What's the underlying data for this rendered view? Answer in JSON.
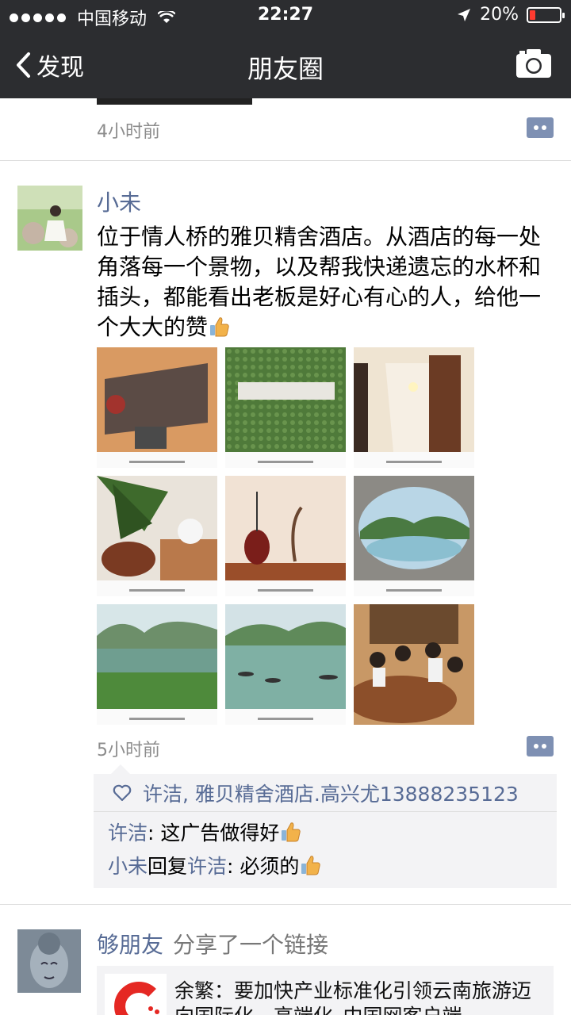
{
  "status": {
    "carrier": "中国移动",
    "time": "22:27",
    "battery": "20%",
    "battery_level": 0.2
  },
  "nav": {
    "back_label": "发现",
    "title": "朋友圈"
  },
  "prev_post": {
    "time": "4小时前"
  },
  "post": {
    "author": "小未",
    "text": "位于情人桥的雅贝精舍酒店。从酒店的每一处角落每一个景物，以及帮我快递遗忘的水杯和插头，都能看出老板是好心有心的人，给他一个大大的赞",
    "time": "5小时前",
    "likes": "许洁, 雅贝精舍酒店.高兴尤13888235123",
    "comments": [
      {
        "from": "许洁",
        "to": "",
        "reply_word": "",
        "text": ": 这广告做得好"
      },
      {
        "from": "小未",
        "to": "许洁",
        "reply_word": "回复",
        "text": ": 必须的"
      }
    ],
    "photo_labels": [
      "雅贝精舍 sign",
      "雅贝精舍 green wall",
      "hallway",
      "lotus",
      "vase decor",
      "round window view",
      "lake view",
      "boats on river",
      "dinner group"
    ]
  },
  "next_post": {
    "author": "够朋友",
    "verb": "分享了一个链接",
    "link_text": "余繁：要加快产业标准化引领云南旅游迈向国际化、高端化_中国网客户端"
  },
  "colors": {
    "topbar": "#2c2d30",
    "link_blue": "#576b95",
    "comment_btn": "#7e90b3",
    "battery_red": "#ff3b30"
  }
}
